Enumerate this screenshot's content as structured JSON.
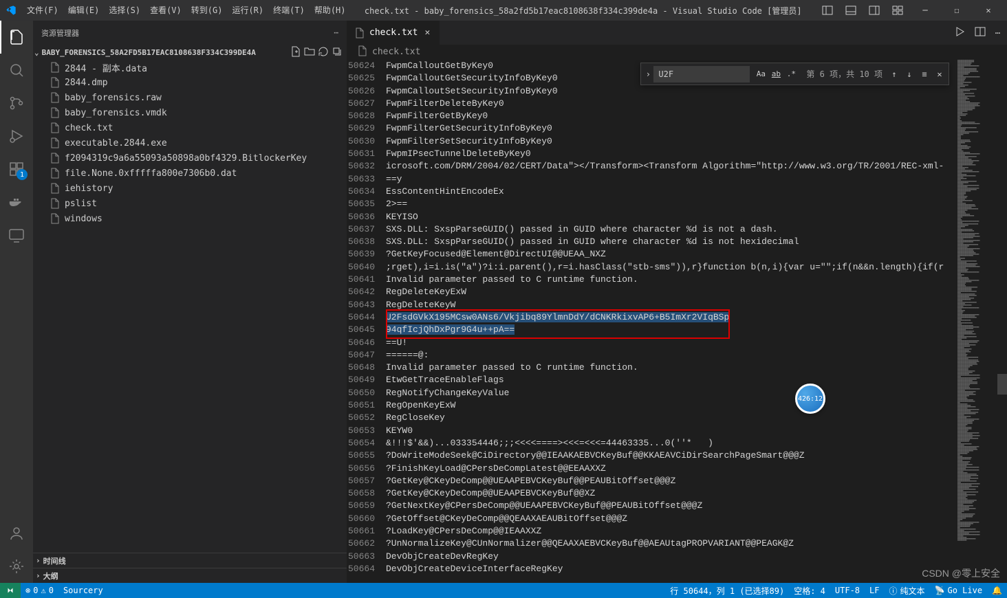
{
  "window": {
    "title": "check.txt - baby_forensics_58a2fd5b17eac8108638f334c399de4a - Visual Studio Code [管理员]"
  },
  "menu": {
    "file": "文件(F)",
    "edit": "编辑(E)",
    "selection": "选择(S)",
    "view": "查看(V)",
    "go": "转到(G)",
    "run": "运行(R)",
    "terminal": "终端(T)",
    "help": "帮助(H)"
  },
  "sidebar": {
    "title": "资源管理器",
    "folder": "BABY_FORENSICS_58A2FD5B17EAC8108638F334C399DE4A",
    "files": [
      {
        "name": "2844 - 副本.data",
        "type": "file"
      },
      {
        "name": "2844.dmp",
        "type": "file"
      },
      {
        "name": "baby_forensics.raw",
        "type": "file"
      },
      {
        "name": "baby_forensics.vmdk",
        "type": "file"
      },
      {
        "name": "check.txt",
        "type": "file"
      },
      {
        "name": "executable.2844.exe",
        "type": "file"
      },
      {
        "name": "f2094319c9a6a55093a50898a0bf4329.BitlockerKey",
        "type": "file"
      },
      {
        "name": "file.None.0xfffffa800e7306b0.dat",
        "type": "file"
      },
      {
        "name": "iehistory",
        "type": "file"
      },
      {
        "name": "pslist",
        "type": "file"
      },
      {
        "name": "windows",
        "type": "file"
      }
    ],
    "sections": {
      "outline": "大纲",
      "timeline": "时间线"
    }
  },
  "tabs": {
    "active": {
      "name": "check.txt"
    }
  },
  "breadcrumb": {
    "path": "check.txt"
  },
  "find": {
    "value": "U2F",
    "results": "第 6 项，共 10 项"
  },
  "editor": {
    "startLine": 50624,
    "lines": [
      "FwpmCalloutGetByKey0",
      "FwpmCalloutGetSecurityInfoByKey0",
      "FwpmCalloutSetSecurityInfoByKey0",
      "FwpmFilterDeleteByKey0",
      "FwpmFilterGetByKey0",
      "FwpmFilterGetSecurityInfoByKey0",
      "FwpmFilterSetSecurityInfoByKey0",
      "FwpmIPsecTunnelDeleteByKey0",
      "icrosoft.com/DRM/2004/02/CERT/Data\"></Transform><Transform Algorithm=\"http://www.w3.org/TR/2001/REC-xml-",
      "==y",
      "EssContentHintEncodeEx",
      "2>==",
      "KEYISO",
      "SXS.DLL: SxspParseGUID() passed in GUID where character %d is not a dash.",
      "SXS.DLL: SxspParseGUID() passed in GUID where character %d is not hexidecimal",
      "?GetKeyFocused@Element@DirectUI@@UEAA_NXZ",
      ";rget),i=i.is(\"a\")?i:i.parent(),r=i.hasClass(\"stb-sms\")),r}function b(n,i){var u=\"\";if(n&&n.length){if(r",
      "Invalid parameter passed to C runtime function.",
      "RegDeleteKeyExW",
      "RegDeleteKeyW",
      "U2FsdGVkX195MCsw0ANs6/Vkjibq89YlmnDdY/dCNKRkixvAP6+B5ImXr2VIqBSp",
      "94qfIcjQhDxPgr9G4u++pA==",
      "==U!",
      "======@:",
      "Invalid parameter passed to C runtime function.",
      "EtwGetTraceEnableFlags",
      "RegNotifyChangeKeyValue",
      "RegOpenKeyExW",
      "RegCloseKey",
      "KEYW0",
      "&!!!$'&&)...033354446;;;<<<<====><<<=<<<=44463335...0(''*   )",
      "?DoWriteModeSeek@CiDirectory@@IEAAKAEBVCKeyBuf@@KKAEAVCiDirSearchPageSmart@@@Z",
      "?FinishKeyLoad@CPersDeCompLatest@@EEAAXXZ",
      "?GetKey@CKeyDeComp@@UEAAPEBVCKeyBuf@@PEAUBitOffset@@@Z",
      "?GetKey@CKeyDeComp@@UEAAPEBVCKeyBuf@@XZ",
      "?GetNextKey@CPersDeComp@@UEAAPEBVCKeyBuf@@PEAUBitOffset@@@Z",
      "?GetOffset@CKeyDeComp@@QEAAXAEAUBitOffset@@@Z",
      "?LoadKey@CPersDeComp@@IEAAXXZ",
      "?UnNormalizeKey@CUnNormalizer@@QEAAXAEBVCKeyBuf@@AEAUtagPROPVARIANT@@PEAGK@Z",
      "DevObjCreateDevRegKey",
      "DevObjCreateDeviceInterfaceRegKey"
    ],
    "highlightedLines": [
      20,
      21
    ]
  },
  "status": {
    "errors": "0",
    "warnings": "0",
    "sourcery": "Sourcery",
    "lineCol": "行 50644，列 1 (已选择89)",
    "spaces": "空格: 4",
    "encoding": "UTF-8",
    "eol": "LF",
    "lang": "纯文本",
    "golive": "Go Live",
    "notifications": ""
  },
  "orb": {
    "text": "426:12"
  },
  "watermark": "CSDN @零上安全",
  "activity": {
    "extensions_badge": "1"
  }
}
